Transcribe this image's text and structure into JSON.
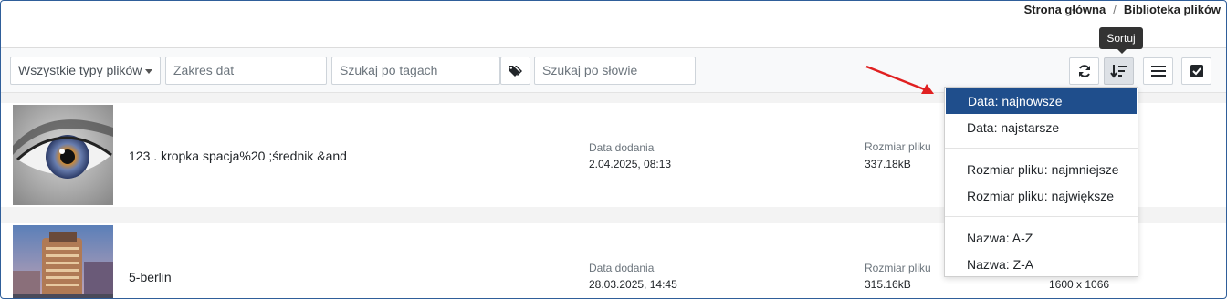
{
  "breadcrumb": {
    "home": "Strona główna",
    "separator": "/",
    "current": "Biblioteka plików"
  },
  "toolbar": {
    "type_select": "Wszystkie typy plików",
    "date_range_placeholder": "Zakres dat",
    "tag_search_placeholder": "Szukaj po tagach",
    "word_search_placeholder": "Szukaj po słowie",
    "sort_tooltip": "Sortuj"
  },
  "files": [
    {
      "name": "123 . kropka spacja%20 ;średnik &and",
      "date_label": "Data dodania",
      "date": "2.04.2025, 08:13",
      "size_label": "Rozmiar pliku",
      "size": "337.18kB"
    },
    {
      "name": "5-berlin",
      "date_label": "Data dodania",
      "date": "28.03.2025, 14:45",
      "size_label": "Rozmiar pliku",
      "size": "315.16kB",
      "dimensions": "1600 x 1066"
    }
  ],
  "sort_menu": {
    "items": [
      "Data: najnowsze",
      "Data: najstarsze",
      "Rozmiar pliku: najmniejsze",
      "Rozmiar pliku: największe",
      "Nazwa: A-Z",
      "Nazwa: Z-A"
    ],
    "selected_index": 0
  },
  "colors": {
    "accent": "#1f4e8c",
    "frame": "#2f5e9a",
    "arrow": "#e02020"
  }
}
